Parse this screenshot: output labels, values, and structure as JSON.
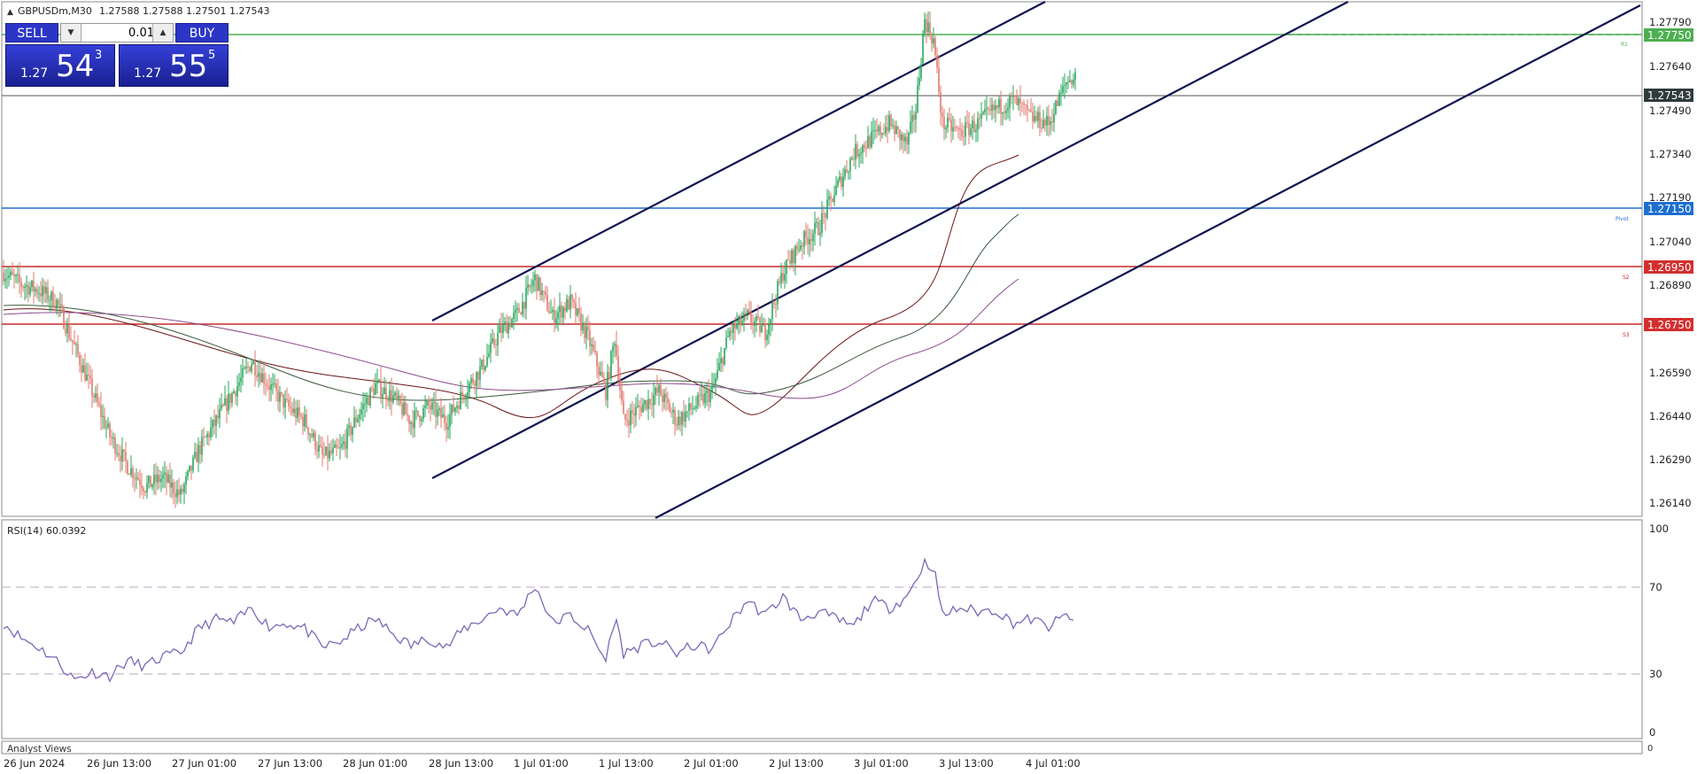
{
  "header": {
    "symbol_timeframe": "GBPUSDm,M30",
    "ohlc": "1.27588 1.27588 1.27501 1.27543"
  },
  "trade_panel": {
    "sell_label": "SELL",
    "buy_label": "BUY",
    "lot_value": "0.01",
    "sell_price_small": "1.27",
    "sell_price_big": "54",
    "sell_price_sup": "3",
    "buy_price_small": "1.27",
    "buy_price_big": "55",
    "buy_price_sup": "5"
  },
  "price_axis": {
    "ticks": [
      "1.27790",
      "1.27640",
      "1.27490",
      "1.27340",
      "1.27190",
      "1.27040",
      "1.26890",
      "1.26590",
      "1.26440",
      "1.26290",
      "1.26140"
    ],
    "labels": {
      "r1": "1.27750",
      "current": "1.27543",
      "pivot": "1.27150",
      "s2": "1.26950",
      "s3": "1.26750"
    }
  },
  "levels": {
    "r1_name": "R1",
    "pivot_name": "Pivot",
    "s2_name": "S2",
    "s3_name": "S3",
    "r1_color": "#4caf50",
    "pivot_color": "#1e6fd0",
    "support_color": "#d32f2f"
  },
  "rsi": {
    "title": "RSI(14) 60.0392",
    "ticks": [
      "100",
      "70",
      "30",
      "0"
    ],
    "line_color": "#7b68b8"
  },
  "bottom_panel": {
    "title": "Analyst Views",
    "scale_label": "0"
  },
  "time_axis": {
    "labels": [
      "26 Jun 2024",
      "26 Jun 13:00",
      "27 Jun 01:00",
      "27 Jun 13:00",
      "28 Jun 01:00",
      "28 Jun 13:00",
      "1 Jul 01:00",
      "1 Jul 13:00",
      "2 Jul 01:00",
      "2 Jul 13:00",
      "3 Jul 01:00",
      "3 Jul 13:00",
      "4 Jul 01:00"
    ]
  },
  "chart_data": {
    "type": "candlestick",
    "symbol": "GBPUSDm",
    "timeframe": "M30",
    "ylim": [
      1.2608,
      1.2781
    ],
    "path": [
      [
        0,
        1.269
      ],
      [
        10,
        1.2686
      ],
      [
        20,
        1.2684
      ],
      [
        30,
        1.268
      ],
      [
        40,
        1.2665
      ],
      [
        50,
        1.265
      ],
      [
        60,
        1.2635
      ],
      [
        70,
        1.2625
      ],
      [
        80,
        1.2618
      ],
      [
        90,
        1.2621
      ],
      [
        100,
        1.2615
      ],
      [
        110,
        1.263
      ],
      [
        120,
        1.264
      ],
      [
        130,
        1.265
      ],
      [
        140,
        1.266
      ],
      [
        150,
        1.2652
      ],
      [
        160,
        1.2645
      ],
      [
        170,
        1.264
      ],
      [
        180,
        1.2628
      ],
      [
        190,
        1.263
      ],
      [
        200,
        1.2642
      ],
      [
        210,
        1.2652
      ],
      [
        220,
        1.2648
      ],
      [
        230,
        1.264
      ],
      [
        240,
        1.2645
      ],
      [
        250,
        1.264
      ],
      [
        260,
        1.265
      ],
      [
        270,
        1.2658
      ],
      [
        280,
        1.267
      ],
      [
        290,
        1.2676
      ],
      [
        300,
        1.2688
      ],
      [
        310,
        1.2675
      ],
      [
        320,
        1.268
      ],
      [
        330,
        1.2668
      ],
      [
        340,
        1.265
      ],
      [
        345,
        1.2668
      ],
      [
        350,
        1.264
      ],
      [
        360,
        1.2645
      ],
      [
        370,
        1.265
      ],
      [
        380,
        1.264
      ],
      [
        390,
        1.2645
      ],
      [
        400,
        1.265
      ],
      [
        410,
        1.267
      ],
      [
        420,
        1.2675
      ],
      [
        430,
        1.267
      ],
      [
        440,
        1.269
      ],
      [
        450,
        1.27
      ],
      [
        460,
        1.2705
      ],
      [
        470,
        1.2718
      ],
      [
        480,
        1.273
      ],
      [
        490,
        1.2735
      ],
      [
        500,
        1.274
      ],
      [
        510,
        1.2733
      ],
      [
        515,
        1.2745
      ],
      [
        520,
        1.2775
      ],
      [
        525,
        1.2768
      ],
      [
        530,
        1.274
      ],
      [
        540,
        1.2737
      ],
      [
        550,
        1.274
      ],
      [
        560,
        1.2745
      ],
      [
        570,
        1.2748
      ],
      [
        580,
        1.2742
      ],
      [
        590,
        1.274
      ],
      [
        600,
        1.2754
      ],
      [
        605,
        1.2756
      ]
    ],
    "rsi_path": [
      [
        0,
        58
      ],
      [
        10,
        50
      ],
      [
        20,
        45
      ],
      [
        30,
        38
      ],
      [
        40,
        28
      ],
      [
        50,
        32
      ],
      [
        60,
        30
      ],
      [
        70,
        38
      ],
      [
        80,
        35
      ],
      [
        90,
        40
      ],
      [
        100,
        42
      ],
      [
        110,
        55
      ],
      [
        120,
        60
      ],
      [
        130,
        58
      ],
      [
        140,
        66
      ],
      [
        150,
        56
      ],
      [
        160,
        58
      ],
      [
        170,
        55
      ],
      [
        180,
        45
      ],
      [
        190,
        48
      ],
      [
        200,
        55
      ],
      [
        210,
        60
      ],
      [
        220,
        52
      ],
      [
        230,
        46
      ],
      [
        240,
        50
      ],
      [
        250,
        45
      ],
      [
        260,
        55
      ],
      [
        270,
        60
      ],
      [
        280,
        66
      ],
      [
        290,
        62
      ],
      [
        300,
        78
      ],
      [
        310,
        58
      ],
      [
        320,
        62
      ],
      [
        330,
        54
      ],
      [
        340,
        38
      ],
      [
        345,
        62
      ],
      [
        350,
        42
      ],
      [
        360,
        46
      ],
      [
        370,
        48
      ],
      [
        380,
        42
      ],
      [
        390,
        46
      ],
      [
        400,
        44
      ],
      [
        410,
        58
      ],
      [
        420,
        70
      ],
      [
        430,
        62
      ],
      [
        440,
        72
      ],
      [
        450,
        60
      ],
      [
        460,
        64
      ],
      [
        470,
        60
      ],
      [
        480,
        56
      ],
      [
        490,
        70
      ],
      [
        500,
        66
      ],
      [
        510,
        72
      ],
      [
        520,
        90
      ],
      [
        525,
        88
      ],
      [
        530,
        62
      ],
      [
        540,
        66
      ],
      [
        550,
        64
      ],
      [
        560,
        65
      ],
      [
        570,
        58
      ],
      [
        580,
        60
      ],
      [
        590,
        56
      ],
      [
        600,
        62
      ],
      [
        605,
        60
      ]
    ],
    "rsi_levels": [
      70,
      30
    ],
    "rsi_ylim": [
      0,
      100
    ],
    "horizontal_levels": [
      1.2775,
      1.2715,
      1.2695,
      1.2675
    ],
    "current_price": 1.27543,
    "channel_lines": [
      [
        [
          245,
          1.2674
        ],
        [
          590,
          1.278
        ]
      ],
      [
        [
          245,
          1.2627
        ],
        [
          760,
          1.278
        ]
      ],
      [
        [
          370,
          1.2612
        ],
        [
          925,
          1.2782
        ]
      ]
    ]
  }
}
